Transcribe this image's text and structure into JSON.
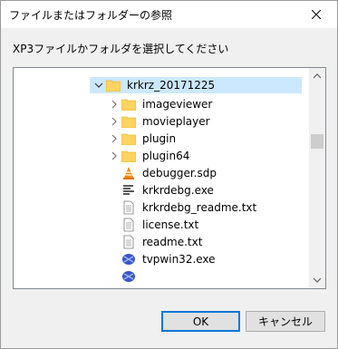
{
  "dialog": {
    "title": "ファイルまたはフォルダーの参照",
    "instruction": "XP3ファイルかフォルダを選択してください",
    "ok_label": "OK",
    "cancel_label": "キャンセル"
  },
  "tree": {
    "items": [
      {
        "label": "krkrz_20171225",
        "type": "folder",
        "expander": "expanded",
        "selected": true
      },
      {
        "label": "imageviewer",
        "type": "folder",
        "expander": "collapsed"
      },
      {
        "label": "movieplayer",
        "type": "folder",
        "expander": "collapsed"
      },
      {
        "label": "plugin",
        "type": "folder",
        "expander": "collapsed"
      },
      {
        "label": "plugin64",
        "type": "folder",
        "expander": "collapsed"
      },
      {
        "label": "debugger.sdp",
        "type": "vlc-file"
      },
      {
        "label": "krkrdebg.exe",
        "type": "exe-file"
      },
      {
        "label": "krkrdebg_readme.txt",
        "type": "text-file"
      },
      {
        "label": "license.txt",
        "type": "text-file"
      },
      {
        "label": "readme.txt",
        "type": "text-file"
      },
      {
        "label": "tvpwin32.exe",
        "type": "app-file"
      }
    ]
  },
  "colors": {
    "selection": "#cce8ff",
    "folder": "#ffd35f",
    "accent": "#0078d7"
  }
}
